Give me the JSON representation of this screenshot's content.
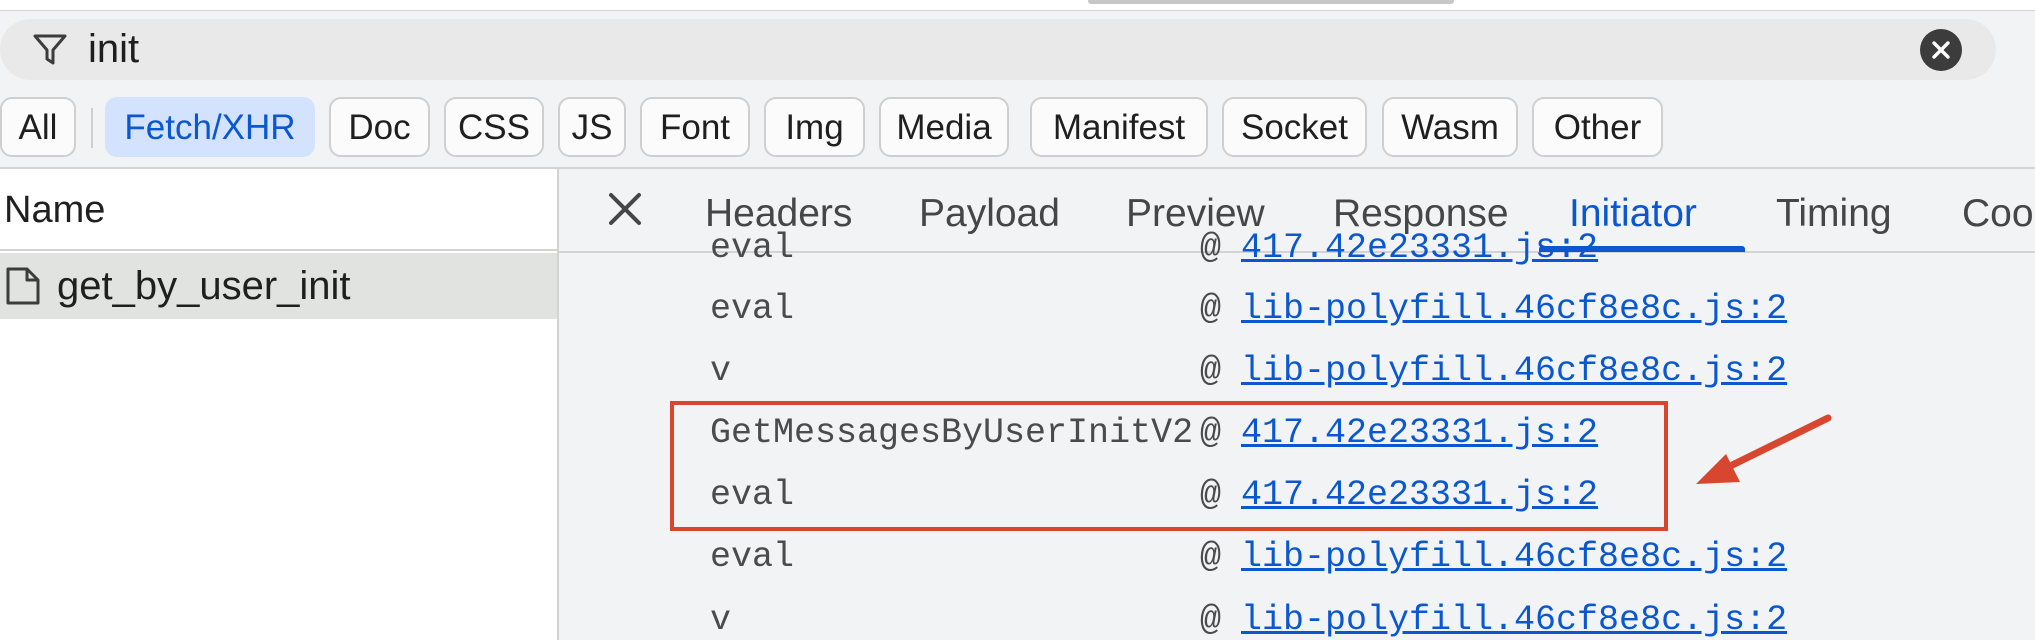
{
  "filter": {
    "value": "init"
  },
  "type_filters": [
    "All",
    "Fetch/XHR",
    "Doc",
    "CSS",
    "JS",
    "Font",
    "Img",
    "Media",
    "Manifest",
    "Socket",
    "Wasm",
    "Other"
  ],
  "active_type": "Fetch/XHR",
  "requests": {
    "header": "Name",
    "items": [
      {
        "name": "get_by_user_init"
      }
    ]
  },
  "detail_tabs": [
    "Headers",
    "Payload",
    "Preview",
    "Response",
    "Initiator",
    "Timing",
    "Coo"
  ],
  "active_tab": "Initiator",
  "call_stack": [
    {
      "fn": "eval",
      "at": "@",
      "source": "417.42e23331.js:2"
    },
    {
      "fn": "eval",
      "at": "@",
      "source": "lib-polyfill.46cf8e8c.js:2"
    },
    {
      "fn": "v",
      "at": "@",
      "source": "lib-polyfill.46cf8e8c.js:2"
    },
    {
      "fn": "GetMessagesByUserInitV2",
      "at": "@",
      "source": "417.42e23331.js:2"
    },
    {
      "fn": "eval",
      "at": "@",
      "source": "417.42e23331.js:2"
    },
    {
      "fn": "eval",
      "at": "@",
      "source": "lib-polyfill.46cf8e8c.js:2"
    },
    {
      "fn": "v",
      "at": "@",
      "source": "lib-polyfill.46cf8e8c.js:2"
    }
  ],
  "icons": {
    "filter": "filter-icon",
    "clear": "clear-icon",
    "close": "close-icon",
    "file": "file-icon",
    "annotation": "arrow-annotation"
  },
  "colors": {
    "accent": "#0b57d0",
    "active_chip": "#d3e3fd",
    "annotation": "#d9462f"
  }
}
